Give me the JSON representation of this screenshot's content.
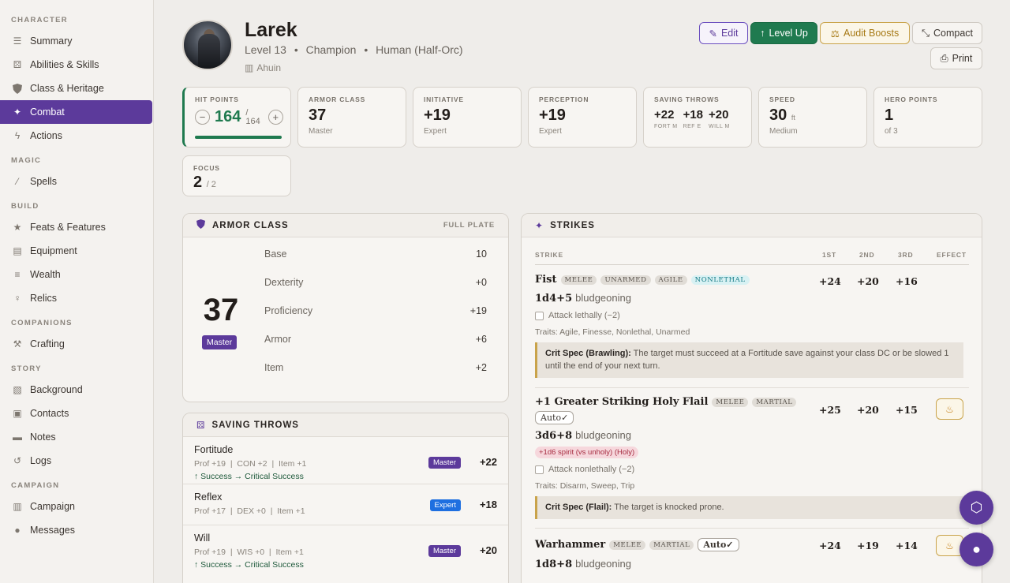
{
  "sidebar": {
    "sections": [
      {
        "title": "CHARACTER",
        "items": [
          {
            "label": "Summary",
            "icon": "list-icon"
          },
          {
            "label": "Abilities & Skills",
            "icon": "dice-icon"
          },
          {
            "label": "Class & Heritage",
            "icon": "shield-icon"
          },
          {
            "label": "Combat",
            "icon": "combat-icon",
            "active": true
          },
          {
            "label": "Actions",
            "icon": "bolt-icon"
          }
        ]
      },
      {
        "title": "MAGIC",
        "items": [
          {
            "label": "Spells",
            "icon": "wand-icon"
          }
        ]
      },
      {
        "title": "BUILD",
        "items": [
          {
            "label": "Feats & Features",
            "icon": "star-icon"
          },
          {
            "label": "Equipment",
            "icon": "chest-icon"
          },
          {
            "label": "Wealth",
            "icon": "coins-icon"
          },
          {
            "label": "Relics",
            "icon": "relic-icon"
          }
        ]
      },
      {
        "title": "COMPANIONS",
        "items": [
          {
            "label": "Crafting",
            "icon": "hammer-icon"
          }
        ]
      },
      {
        "title": "STORY",
        "items": [
          {
            "label": "Background",
            "icon": "scroll-icon"
          },
          {
            "label": "Contacts",
            "icon": "contacts-icon"
          },
          {
            "label": "Notes",
            "icon": "note-icon"
          },
          {
            "label": "Logs",
            "icon": "history-icon"
          }
        ]
      },
      {
        "title": "CAMPAIGN",
        "items": [
          {
            "label": "Campaign",
            "icon": "map-icon"
          },
          {
            "label": "Messages",
            "icon": "messages-icon"
          }
        ]
      }
    ]
  },
  "header": {
    "name": "Larek",
    "level": "Level 13",
    "class": "Champion",
    "ancestry": "Human (Half-Orc)",
    "sep": "•",
    "deity": "Ahuin",
    "buttons": {
      "edit": "Edit",
      "level_up": "Level Up",
      "audit": "Audit Boosts",
      "compact": "Compact",
      "print": "Print"
    }
  },
  "stats": {
    "hp": {
      "label": "HIT POINTS",
      "current": "164",
      "slash": "/",
      "max": "164",
      "fill": 1.0
    },
    "ac": {
      "label": "ARMOR CLASS",
      "value": "37",
      "sub": "Master"
    },
    "initiative": {
      "label": "INITIATIVE",
      "value": "+19",
      "sub": "Expert"
    },
    "perception": {
      "label": "PERCEPTION",
      "value": "+19",
      "sub": "Expert"
    },
    "saves": {
      "label": "SAVING THROWS",
      "fort": "+22",
      "fort_l": "FORT M",
      "ref": "+18",
      "ref_l": "REF E",
      "will": "+20",
      "will_l": "WILL M"
    },
    "speed": {
      "label": "SPEED",
      "value": "30",
      "unit": "ft",
      "sub": "Medium"
    },
    "hero": {
      "label": "HERO POINTS",
      "value": "1",
      "sub": "of 3"
    },
    "focus": {
      "label": "FOCUS",
      "value": "2",
      "max": "/ 2"
    }
  },
  "armor_panel": {
    "title": "ARMOR CLASS",
    "armor": "FULL PLATE",
    "total": "37",
    "rank": "Master",
    "rows": [
      {
        "label": "Base",
        "value": "10"
      },
      {
        "label": "Dexterity",
        "value": "+0"
      },
      {
        "label": "Proficiency",
        "value": "+19"
      },
      {
        "label": "Armor",
        "value": "+6"
      },
      {
        "label": "Item",
        "value": "+2"
      }
    ]
  },
  "saves_panel": {
    "title": "SAVING THROWS",
    "rows": [
      {
        "name": "Fortitude",
        "detail": "Prof +19  |  CON +2  |  Item +1",
        "extra": "↑ Success → Critical Success",
        "rank": "Master",
        "total": "+22"
      },
      {
        "name": "Reflex",
        "detail": "Prof +17  |  DEX +0  |  Item +1",
        "extra": "",
        "rank": "Expert",
        "total": "+18"
      },
      {
        "name": "Will",
        "detail": "Prof +19  |  WIS +0  |  Item +1",
        "extra": "↑ Success → Critical Success",
        "rank": "Master",
        "total": "+20"
      }
    ]
  },
  "strikes_panel": {
    "title": "STRIKES",
    "columns": {
      "strike": "STRIKE",
      "first": "1ST",
      "second": "2ND",
      "third": "3RD",
      "effect": "EFFECT"
    },
    "strikes": [
      {
        "name": "Fist",
        "traits": [
          "MELEE",
          "UNARMED",
          "AGILE"
        ],
        "special_trait": "NONLETHAL",
        "a1": "+24",
        "a2": "+20",
        "a3": "+16",
        "damage": "1d4+5",
        "dtype": "bludgeoning",
        "toggle": "Attack lethally (−2)",
        "traits_line": "Traits: Agile, Finesse, Nonlethal, Unarmed",
        "crit_title": "Crit Spec (Brawling):",
        "crit_text": "The target must succeed at a Fortitude save against your class DC or be slowed 1 until the end of your next turn."
      },
      {
        "name": "+1 Greater Striking Holy Flail",
        "traits": [
          "MELEE",
          "MARTIAL"
        ],
        "select": "Auto",
        "a1": "+25",
        "a2": "+20",
        "a3": "+15",
        "damage": "3d6+8",
        "dtype": "bludgeoning",
        "extra_damage": "+1d6 spirit (vs unholy) (Holy)",
        "toggle": "Attack nonlethally (−2)",
        "traits_line": "Traits: Disarm, Sweep, Trip",
        "crit_title": "Crit Spec (Flail):",
        "crit_text": "The target is knocked prone."
      },
      {
        "name": "Warhammer",
        "traits": [
          "MELEE",
          "MARTIAL"
        ],
        "select": "Auto",
        "a1": "+24",
        "a2": "+19",
        "a3": "+14",
        "damage": "1d8+8",
        "dtype": "bludgeoning"
      }
    ]
  },
  "colors": {
    "accent": "#5c3a9b",
    "success": "#1f7a4f",
    "gold": "#c9a34a"
  }
}
